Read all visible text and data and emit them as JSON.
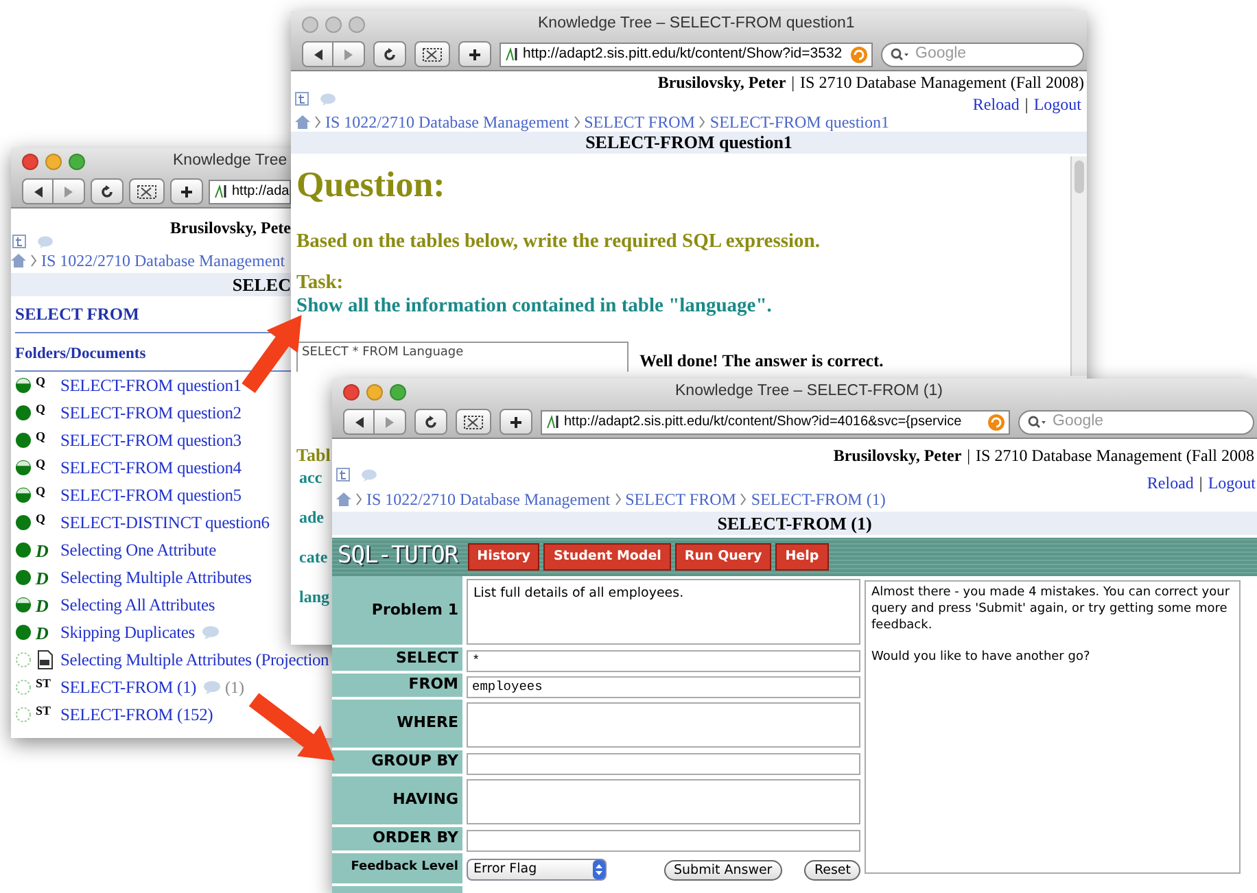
{
  "back_window": {
    "title": "Knowledge Tree",
    "active": true,
    "url": "http://ada",
    "user": "Brusilovsky, Pete",
    "breadcrumb": [
      "IS 1022/2710 Database Management"
    ],
    "header": "SELEC",
    "section": "SELECT FROM",
    "subsection": "Folders/Documents",
    "items": [
      {
        "label": "SELECT-FROM question1",
        "started": true,
        "completed": false,
        "kind": "badge",
        "badge": "Q"
      },
      {
        "label": "SELECT-FROM question2",
        "started": true,
        "completed": true,
        "kind": "badge",
        "badge": "Q"
      },
      {
        "label": "SELECT-FROM question3",
        "started": true,
        "completed": true,
        "kind": "badge",
        "badge": "Q"
      },
      {
        "label": "SELECT-FROM question4",
        "started": true,
        "completed": false,
        "kind": "badge",
        "badge": "Q"
      },
      {
        "label": "SELECT-FROM question5",
        "started": true,
        "completed": false,
        "kind": "badge",
        "badge": "Q"
      },
      {
        "label": "SELECT-DISTINCT question6",
        "started": true,
        "completed": true,
        "kind": "badge",
        "badge": "Q"
      },
      {
        "label": "Selecting One Attribute",
        "started": true,
        "completed": true,
        "kind": "example",
        "badge": "D"
      },
      {
        "label": "Selecting Multiple Attributes",
        "started": true,
        "completed": true,
        "kind": "example",
        "badge": "D"
      },
      {
        "label": "Selecting All Attributes",
        "started": true,
        "completed": false,
        "kind": "example",
        "badge": "D"
      },
      {
        "label": "Skipping Duplicates",
        "started": true,
        "completed": true,
        "kind": "example",
        "badge": "D",
        "comment": true
      },
      {
        "label": "Selecting Multiple Attributes (Projection",
        "started": false,
        "kind": "document"
      },
      {
        "label": "SELECT-FROM (1)",
        "started": false,
        "kind": "badge",
        "badge": "ST",
        "comment": true,
        "comment_count": "(1)"
      },
      {
        "label": "SELECT-FROM (152)",
        "started": false,
        "kind": "badge",
        "badge": "ST"
      }
    ]
  },
  "middle_window": {
    "title": "Knowledge Tree – SELECT-FROM question1",
    "active": false,
    "url": "http://adapt2.sis.pitt.edu/kt/content/Show?id=3532",
    "search_placeholder": "Google",
    "user": "Brusilovsky, Peter",
    "separator": "|",
    "course": "IS 2710 Database Management (Fall 2008)",
    "links": [
      "Reload",
      "Logout"
    ],
    "link_separator": "|",
    "breadcrumb": [
      "IS 1022/2710 Database Management",
      "SELECT FROM",
      "SELECT-FROM question1"
    ],
    "header": "SELECT-FROM question1",
    "question_heading": "Question:",
    "instruction": "Based on the tables below, write the required SQL expression.",
    "task_label": "Task:",
    "task": "Show all the information contained in table \"language\".",
    "answer": "SELECT * FROM Language",
    "result": "Well done! The answer is correct.",
    "tables_heading": "Tabl",
    "tables": [
      "acc",
      "ade",
      "cate",
      "lang"
    ]
  },
  "front_window": {
    "title": "Knowledge Tree – SELECT-FROM (1)",
    "active": true,
    "url": "http://adapt2.sis.pitt.edu/kt/content/Show?id=4016&svc={pservice",
    "search_placeholder": "Google",
    "user": "Brusilovsky, Peter",
    "separator": "|",
    "course": "IS 2710 Database Management (Fall 2008",
    "links": [
      "Reload",
      "Logout"
    ],
    "link_separator": "|",
    "breadcrumb": [
      "IS 1022/2710 Database Management",
      "SELECT FROM",
      "SELECT-FROM (1)"
    ],
    "header": "SELECT-FROM (1)",
    "logo": "SQL-TUTOR",
    "menu": [
      "History",
      "Student Model",
      "Run Query",
      "Help"
    ],
    "problem_label": "Problem 1",
    "problem": "List full details of all employees.",
    "clauses": [
      {
        "label": "SELECT",
        "kind": "line",
        "value": "*"
      },
      {
        "label": "FROM",
        "kind": "line",
        "value": "employees"
      },
      {
        "label": "WHERE",
        "kind": "area"
      },
      {
        "label": "GROUP BY",
        "kind": "line"
      },
      {
        "label": "HAVING",
        "kind": "area"
      },
      {
        "label": "ORDER BY",
        "kind": "line"
      }
    ],
    "feedback_level_label": "Feedback Level",
    "feedback_level": "Error Flag",
    "buttons": [
      "Submit Answer",
      "Reset"
    ],
    "feedback": [
      "Almost there - you made 4 mistakes. You can correct your query and press 'Submit' again, or try getting some more feedback.",
      "Would you like to have another go?"
    ]
  }
}
